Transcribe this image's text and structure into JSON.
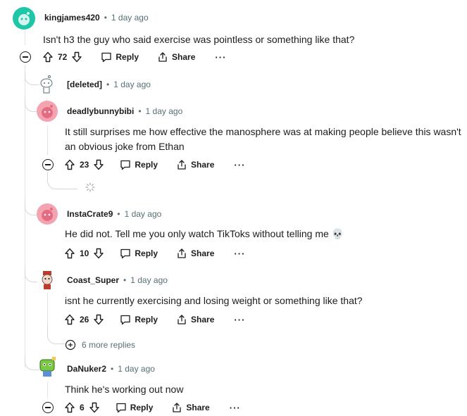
{
  "comments": [
    {
      "username": "kingjames420",
      "time": "1 day ago",
      "text": "Isn't h3 the guy who said exercise was pointless or something like that?",
      "votes": "72",
      "reply_label": "Reply",
      "share_label": "Share",
      "more_label": "···",
      "avatar_color": "#1ec6a8"
    },
    {
      "username": "[deleted]",
      "time": "1 day ago"
    },
    {
      "username": "deadlybunnybibi",
      "time": "1 day ago",
      "text": "It still surprises me how effective the manosphere was at making people believe this wasn't an obvious joke from Ethan",
      "votes": "23",
      "reply_label": "Reply",
      "share_label": "Share",
      "more_label": "···",
      "avatar_color": "#f08ea0"
    },
    {
      "username": "InstaCrate9",
      "time": "1 day ago",
      "text": "He did not. Tell me you only watch TikToks without telling me 💀",
      "votes": "10",
      "reply_label": "Reply",
      "share_label": "Share",
      "more_label": "···",
      "avatar_color": "#f08ea0"
    },
    {
      "username": "Coast_Super",
      "time": "1 day ago",
      "text": "isnt he currently exercising and losing weight or something like that?",
      "votes": "26",
      "reply_label": "Reply",
      "share_label": "Share",
      "more_label": "···",
      "avatar_color": "#ffffff"
    },
    {
      "username": "DaNuker2",
      "time": "1 day ago",
      "text": "Think he's working out now",
      "votes": "6",
      "reply_label": "Reply",
      "share_label": "Share",
      "more_label": "···",
      "avatar_color": "#7ac943"
    }
  ],
  "more_replies_label": "6 more replies",
  "separator": "•",
  "colors": {
    "text": "#1c1c1c",
    "meta": "#576f76",
    "thread_line": "#e2e4e6"
  }
}
